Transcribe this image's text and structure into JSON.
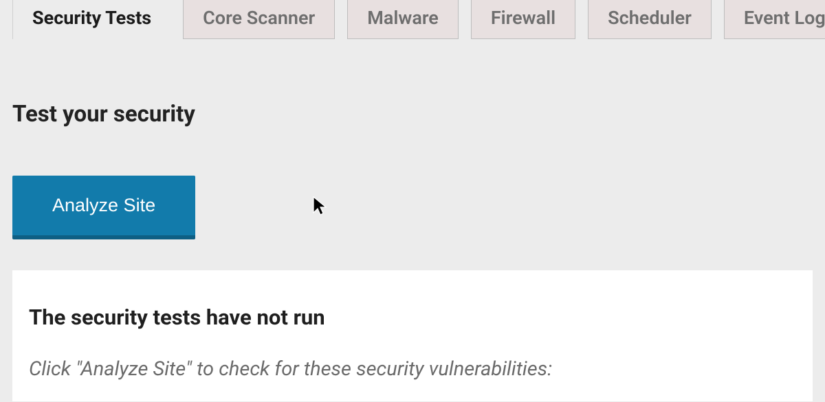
{
  "tabs": {
    "items": [
      {
        "label": "Security Tests",
        "active": true
      },
      {
        "label": "Core Scanner",
        "active": false
      },
      {
        "label": "Malware",
        "active": false
      },
      {
        "label": "Firewall",
        "active": false
      },
      {
        "label": "Scheduler",
        "active": false
      },
      {
        "label": "Event Log",
        "active": false
      }
    ]
  },
  "main": {
    "heading": "Test your security",
    "analyze_button_label": "Analyze Site"
  },
  "card": {
    "title": "The security tests have not run",
    "subtext": "Click \"Analyze Site\" to check for these security vulnerabilities:"
  }
}
